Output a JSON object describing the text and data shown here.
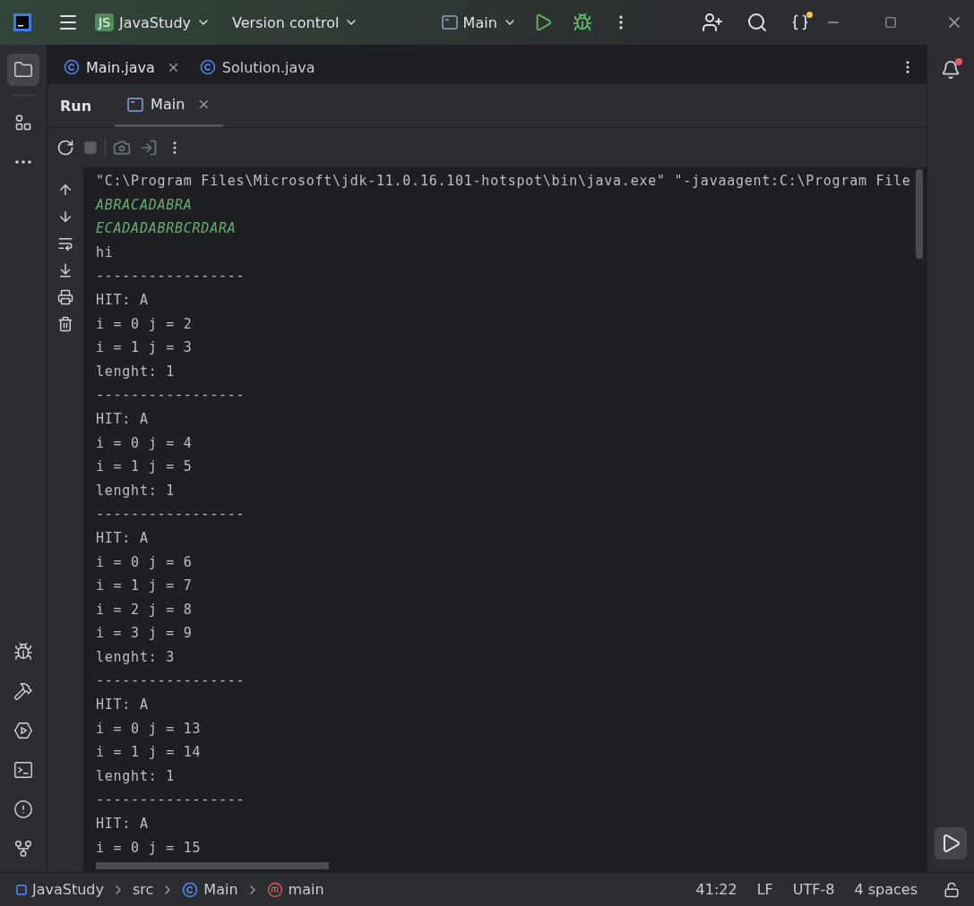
{
  "title_bar": {
    "project_badge": "JS",
    "project": "JavaStudy",
    "vcs": "Version control",
    "run_config": "Main"
  },
  "left_stripe": {
    "top": [
      {
        "kind": "project",
        "selected": true
      },
      {
        "kind": "structure",
        "selected": false
      },
      {
        "kind": "more",
        "selected": false
      }
    ],
    "bottom": [
      {
        "kind": "debug",
        "selected": false
      },
      {
        "kind": "build",
        "selected": false
      },
      {
        "kind": "services",
        "selected": false
      },
      {
        "kind": "terminal",
        "selected": false
      },
      {
        "kind": "problems",
        "selected": false
      },
      {
        "kind": "git",
        "selected": false
      }
    ]
  },
  "editor_tabs": [
    {
      "label": "Main.java",
      "selected": true
    },
    {
      "label": "Solution.java",
      "selected": false
    }
  ],
  "run_panel": {
    "title": "Run",
    "tabs": [
      {
        "label": "Main",
        "selected": true
      }
    ]
  },
  "console": {
    "lines": [
      {
        "kind": "command",
        "text": "\"C:\\Program Files\\Microsoft\\jdk-11.0.16.101-hotspot\\bin\\java.exe\" \"-javaagent:C:\\Program File"
      },
      {
        "kind": "input",
        "text": "ABRACADABRA"
      },
      {
        "kind": "input",
        "text": "ECADADABRBCRDARA"
      },
      {
        "kind": "output",
        "text": "hi"
      },
      {
        "kind": "output",
        "text": "-----------------"
      },
      {
        "kind": "output",
        "text": "HIT: A"
      },
      {
        "kind": "output",
        "text": "i = 0 j = 2"
      },
      {
        "kind": "output",
        "text": "i = 1 j = 3"
      },
      {
        "kind": "output",
        "text": "lenght: 1"
      },
      {
        "kind": "output",
        "text": "-----------------"
      },
      {
        "kind": "output",
        "text": "HIT: A"
      },
      {
        "kind": "output",
        "text": "i = 0 j = 4"
      },
      {
        "kind": "output",
        "text": "i = 1 j = 5"
      },
      {
        "kind": "output",
        "text": "lenght: 1"
      },
      {
        "kind": "output",
        "text": "-----------------"
      },
      {
        "kind": "output",
        "text": "HIT: A"
      },
      {
        "kind": "output",
        "text": "i = 0 j = 6"
      },
      {
        "kind": "output",
        "text": "i = 1 j = 7"
      },
      {
        "kind": "output",
        "text": "i = 2 j = 8"
      },
      {
        "kind": "output",
        "text": "i = 3 j = 9"
      },
      {
        "kind": "output",
        "text": "lenght: 3"
      },
      {
        "kind": "output",
        "text": "-----------------"
      },
      {
        "kind": "output",
        "text": "HIT: A"
      },
      {
        "kind": "output",
        "text": "i = 0 j = 13"
      },
      {
        "kind": "output",
        "text": "i = 1 j = 14"
      },
      {
        "kind": "output",
        "text": "lenght: 1"
      },
      {
        "kind": "output",
        "text": "-----------------"
      },
      {
        "kind": "output",
        "text": "HIT: A"
      },
      {
        "kind": "output",
        "text": "i = 0 j = 15"
      }
    ]
  },
  "notifications": {
    "unread": true
  },
  "status_bar": {
    "breadcrumbs": [
      {
        "kind": "project",
        "label": "JavaStudy"
      },
      {
        "kind": "folder",
        "label": "src"
      },
      {
        "kind": "class",
        "label": "Main"
      },
      {
        "kind": "method",
        "label": "main"
      }
    ],
    "position": "41:22",
    "line_separator": "LF",
    "encoding": "UTF-8",
    "indent": "4 spaces"
  }
}
